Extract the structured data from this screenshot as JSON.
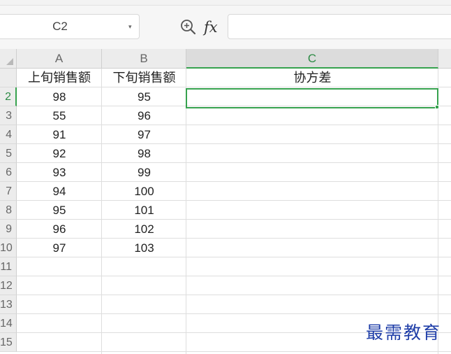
{
  "formula_bar": {
    "cell_reference": "C2",
    "dropdown_icon": "chevron-down-icon",
    "zoom_icon": "magnifier-icon",
    "function_label": "fx",
    "formula": ""
  },
  "sheet": {
    "columns": [
      "A",
      "B",
      "C"
    ],
    "active_column": "C",
    "row_numbers": [
      "",
      "2",
      "3",
      "4",
      "5",
      "6",
      "7",
      "8",
      "9",
      "10",
      "11",
      "12",
      "13",
      "14",
      "15"
    ],
    "rows": [
      [
        "上旬销售额",
        "下旬销售额",
        "协方差"
      ],
      [
        "98",
        "95",
        ""
      ],
      [
        "55",
        "96",
        ""
      ],
      [
        "91",
        "97",
        ""
      ],
      [
        "92",
        "98",
        ""
      ],
      [
        "93",
        "99",
        ""
      ],
      [
        "94",
        "100",
        ""
      ],
      [
        "95",
        "101",
        ""
      ],
      [
        "96",
        "102",
        ""
      ],
      [
        "97",
        "103",
        ""
      ],
      [
        "",
        "",
        ""
      ],
      [
        "",
        "",
        ""
      ],
      [
        "",
        "",
        ""
      ],
      [
        "",
        "",
        ""
      ],
      [
        "",
        "",
        ""
      ]
    ],
    "selected_cell": "C2"
  },
  "watermark": "最需教育",
  "colors": {
    "selection": "#36a24e",
    "header_bg": "#ececec",
    "watermark": "#1f3ea8"
  }
}
